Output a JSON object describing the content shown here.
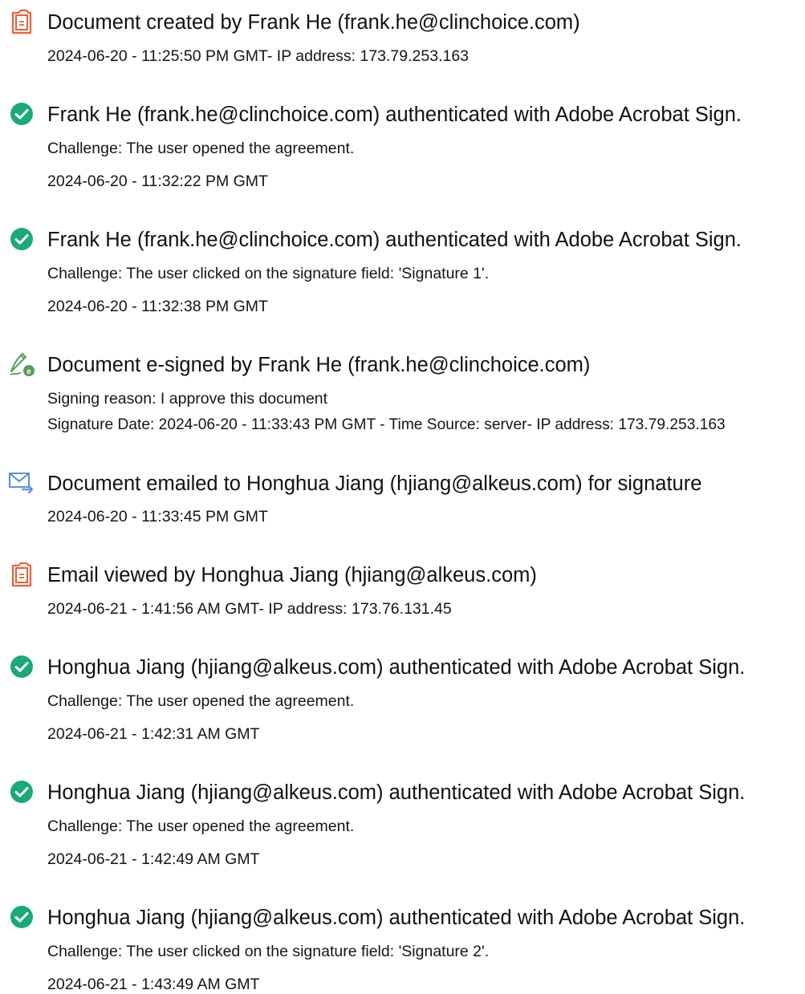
{
  "colors": {
    "check_green": "#1aa97a",
    "doc_orange": "#e5623a",
    "mail_blue": "#5b8fd8",
    "sign_green": "#5a9a5e",
    "text": "#111111"
  },
  "entries": [
    {
      "icon": "document-created-icon",
      "title": "Document created by Frank He (frank.he@clinchoice.com)",
      "lines": [
        "2024-06-20 - 11:25:50 PM GMT- IP address: 173.79.253.163"
      ]
    },
    {
      "icon": "check-circle-icon",
      "title": "Frank He (frank.he@clinchoice.com) authenticated with Adobe Acrobat Sign.",
      "lines": [
        "Challenge: The user opened the agreement.",
        "2024-06-20 - 11:32:22 PM GMT"
      ]
    },
    {
      "icon": "check-circle-icon",
      "title": "Frank He (frank.he@clinchoice.com) authenticated with Adobe Acrobat Sign.",
      "lines": [
        "Challenge: The user clicked on the signature field: 'Signature 1'.",
        "2024-06-20 - 11:32:38 PM GMT"
      ]
    },
    {
      "icon": "e-sign-pen-icon",
      "title": "Document e-signed by Frank He (frank.he@clinchoice.com)",
      "lines": [
        "Signing reason: I approve this document",
        "Signature Date: 2024-06-20 - 11:33:43 PM GMT - Time Source: server- IP address: 173.79.253.163"
      ]
    },
    {
      "icon": "email-sent-icon",
      "title": "Document emailed to Honghua Jiang (hjiang@alkeus.com) for signature",
      "lines": [
        "2024-06-20 - 11:33:45 PM GMT"
      ]
    },
    {
      "icon": "document-viewed-icon",
      "title": "Email viewed by Honghua Jiang (hjiang@alkeus.com)",
      "lines": [
        "2024-06-21 - 1:41:56 AM GMT- IP address: 173.76.131.45"
      ]
    },
    {
      "icon": "check-circle-icon",
      "title": "Honghua Jiang (hjiang@alkeus.com) authenticated with Adobe Acrobat Sign.",
      "lines": [
        "Challenge: The user opened the agreement.",
        "2024-06-21 - 1:42:31 AM GMT"
      ]
    },
    {
      "icon": "check-circle-icon",
      "title": "Honghua Jiang (hjiang@alkeus.com) authenticated with Adobe Acrobat Sign.",
      "lines": [
        "Challenge: The user opened the agreement.",
        "2024-06-21 - 1:42:49 AM GMT"
      ]
    },
    {
      "icon": "check-circle-icon",
      "title": "Honghua Jiang (hjiang@alkeus.com) authenticated with Adobe Acrobat Sign.",
      "lines": [
        "Challenge: The user clicked on the signature field: 'Signature 2'.",
        "2024-06-21 - 1:43:49 AM GMT"
      ]
    }
  ]
}
